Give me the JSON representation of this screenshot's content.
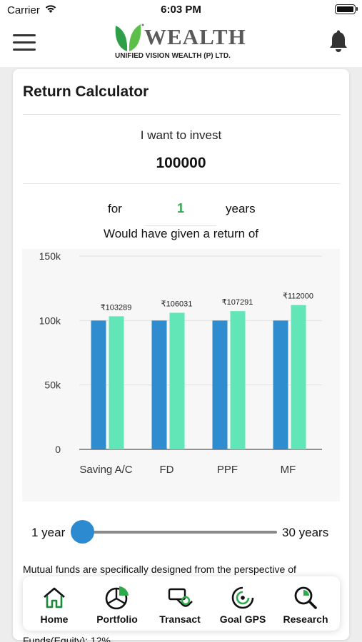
{
  "status_bar": {
    "carrier": "Carrier",
    "time": "6:03 PM"
  },
  "header": {
    "logo_text": "WEALTH",
    "logo_tagline": "UNIFIED VISION WEALTH (P) LTD.",
    "menu_icon": "hamburger-icon",
    "notification_icon": "bell-icon"
  },
  "calculator": {
    "title": "Return Calculator",
    "invest_label": "I want to invest",
    "amount": "100000",
    "for_label": "for",
    "years_value": "1",
    "years_label": "years",
    "return_label": "Would have given a return of"
  },
  "slider": {
    "min_label": "1 year",
    "max_label": "30 years",
    "value": 1,
    "min": 1,
    "max": 30
  },
  "description": "Mutual funds are specifically designed from the perspective of",
  "description_partial": "Funds(Equity): 12%",
  "colors": {
    "invested": "#2e8ccf",
    "returns": "#63e6b7",
    "accent": "#2daa4a",
    "slider": "#2b8ad0"
  },
  "chart_data": {
    "type": "bar",
    "categories": [
      "Saving A/C",
      "FD",
      "PPF",
      "MF"
    ],
    "series": [
      {
        "values": [
          100000,
          100000,
          100000,
          100000
        ]
      },
      {
        "values": [
          103289,
          106031,
          107291,
          112000
        ]
      }
    ],
    "data_labels": [
      "₹103289",
      "₹106031",
      "₹107291",
      "₹112000"
    ],
    "yticks": [
      "0",
      "50k",
      "100k",
      "150k"
    ],
    "ylim": [
      0,
      150000
    ],
    "grid": true
  },
  "tabs": [
    {
      "label": "Home",
      "icon": "home-icon"
    },
    {
      "label": "Portfolio",
      "icon": "pie-chart-icon"
    },
    {
      "label": "Transact",
      "icon": "transact-icon"
    },
    {
      "label": "Goal GPS",
      "icon": "target-icon"
    },
    {
      "label": "Research",
      "icon": "research-icon"
    }
  ]
}
